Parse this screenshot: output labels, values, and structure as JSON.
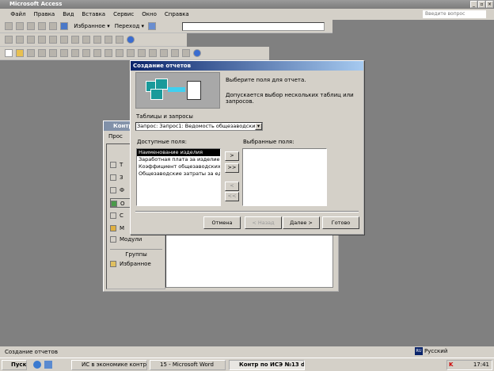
{
  "app": {
    "title": "Microsoft Access"
  },
  "menu": [
    "Файл",
    "Правка",
    "Вид",
    "Вставка",
    "Сервис",
    "Окно",
    "Справка"
  ],
  "ask_placeholder": "Введите вопрос",
  "toolbar": {
    "favorites": "Избранное ▾",
    "goto": "Переход ▾"
  },
  "db_window": {
    "title": "Контр",
    "toolbar_preview": "Прос",
    "objects_header": "Об",
    "items": [
      "Т",
      "З",
      "Ф",
      "О",
      "С",
      "М",
      "Модули"
    ],
    "groups_header": "Группы",
    "favorites": "Избранное"
  },
  "dialog": {
    "title": "Создание отчетов",
    "instruction": "Выберите поля для отчета.",
    "hint": "Допускается выбор нескольких таблиц или запросов.",
    "tables_label": "Таблицы и запросы",
    "tables_value": "Запрос: Запрос1: Ведомость общезаводских за",
    "available_label": "Доступные поля:",
    "available": [
      "Наименование изделия",
      "Заработная плата за изделие",
      "Коэффициент общезаводских зат",
      "Общезаводские затраты за един"
    ],
    "selected_label": "Выбранные поля:",
    "selected": [],
    "move_one": ">",
    "move_all": ">>",
    "remove_one": "<",
    "remove_all": "<<",
    "cancel": "Отмена",
    "back": "< Назад",
    "next": "Далее >",
    "finish": "Готово"
  },
  "status": {
    "text": "Создание отчетов",
    "language": "Русский",
    "lang_code": "RU"
  },
  "taskbar": {
    "start": "Пуск",
    "tasks": [
      "ИС в экономике контро...",
      "15 - Microsoft Word",
      "Контр по ИСЭ №13  d..."
    ],
    "clock": "17:41"
  }
}
